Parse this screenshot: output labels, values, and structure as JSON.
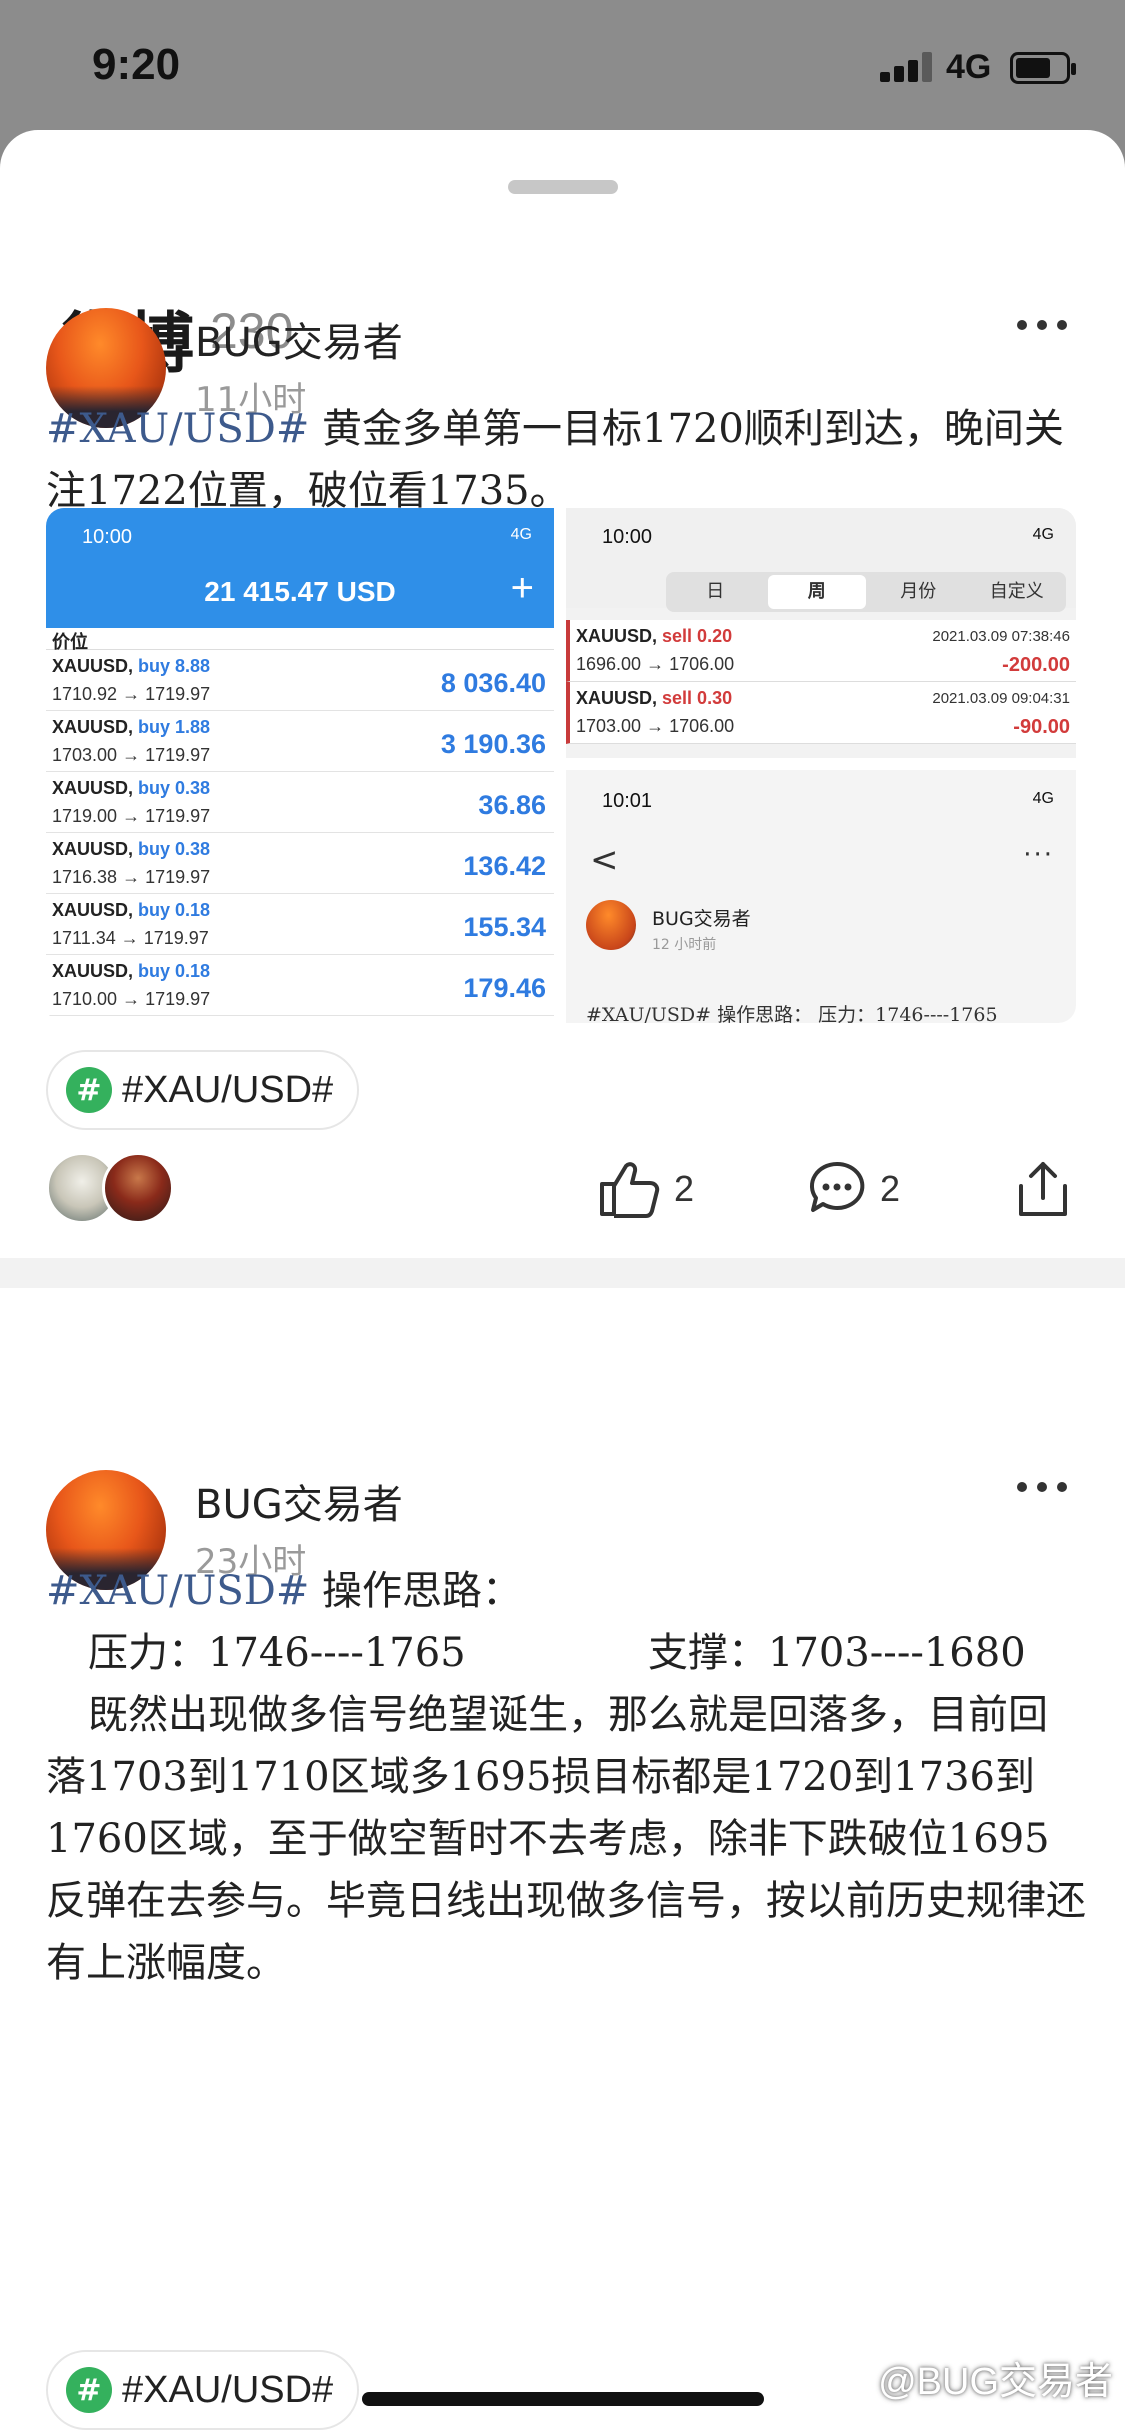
{
  "status_bar": {
    "time": "9:20",
    "network": "4G"
  },
  "header": {
    "title": "微博",
    "count": "230"
  },
  "posts": [
    {
      "author": "BUG交易者",
      "time_ago": "11小时",
      "hashtag": "#XAU/USD#",
      "text": " 黄金多单第一目标1720顺利到达，晚间关注1722位置，破位看1735。",
      "topic_chip": "#XAU/USD#",
      "likes": "2",
      "comments": "2",
      "images": {
        "mt": {
          "time": "10:00",
          "status": "4G",
          "balance": "21 415.47 USD",
          "plus": "+",
          "column": "价位",
          "rows": [
            {
              "symbol": "XAUUSD,",
              "side": "buy 8.88",
              "prices": "1710.92 → 1719.97",
              "profit": "8 036.40"
            },
            {
              "symbol": "XAUUSD,",
              "side": "buy 1.88",
              "prices": "1703.00 → 1719.97",
              "profit": "3 190.36"
            },
            {
              "symbol": "XAUUSD,",
              "side": "buy 0.38",
              "prices": "1719.00 → 1719.97",
              "profit": "36.86"
            },
            {
              "symbol": "XAUUSD,",
              "side": "buy 0.38",
              "prices": "1716.38 → 1719.97",
              "profit": "136.42"
            },
            {
              "symbol": "XAUUSD,",
              "side": "buy 0.18",
              "prices": "1711.34 → 1719.97",
              "profit": "155.34"
            },
            {
              "symbol": "XAUUSD,",
              "side": "buy 0.18",
              "prices": "1710.00 → 1719.97",
              "profit": "179.46"
            }
          ]
        },
        "history": {
          "time": "10:00",
          "status": "4G",
          "segments": [
            "日",
            "周",
            "月份",
            "自定义"
          ],
          "rows": [
            {
              "symbol": "XAUUSD,",
              "side": "sell 0.20",
              "prices": "1696.00 → 1706.00",
              "date": "2021.03.09 07:38:46",
              "profit": "-200.00"
            },
            {
              "symbol": "XAUUSD,",
              "side": "sell 0.30",
              "prices": "1703.00 → 1706.00",
              "date": "2021.03.09 09:04:31",
              "profit": "-90.00"
            }
          ]
        },
        "weibo": {
          "time": "10:01",
          "status": "4G",
          "back": "<",
          "more": "···",
          "name": "BUG交易者",
          "ago": "12 小时前",
          "text": "#XAU/USD# 操作思路：  压力：1746----1765"
        }
      }
    },
    {
      "author": "BUG交易者",
      "time_ago": "23小时",
      "hashtag": "#XAU/USD#",
      "title_rest": " 操作思路：",
      "pressure": "压力：1746----1765",
      "support": "支撑：1703----1680",
      "paragraph": "既然出现做多信号绝望诞生，那么就是回落多，目前回落1703到1710区域多1695损目标都是1720到1736到1760区域，至于做空暂时不去考虑，除非下跌破位1695反弹在去参与。毕竟日线出现做多信号，按以前历史规律还有上涨幅度。",
      "topic_chip": "#XAU/USD#"
    }
  ],
  "watermark": "@BUG交易者"
}
